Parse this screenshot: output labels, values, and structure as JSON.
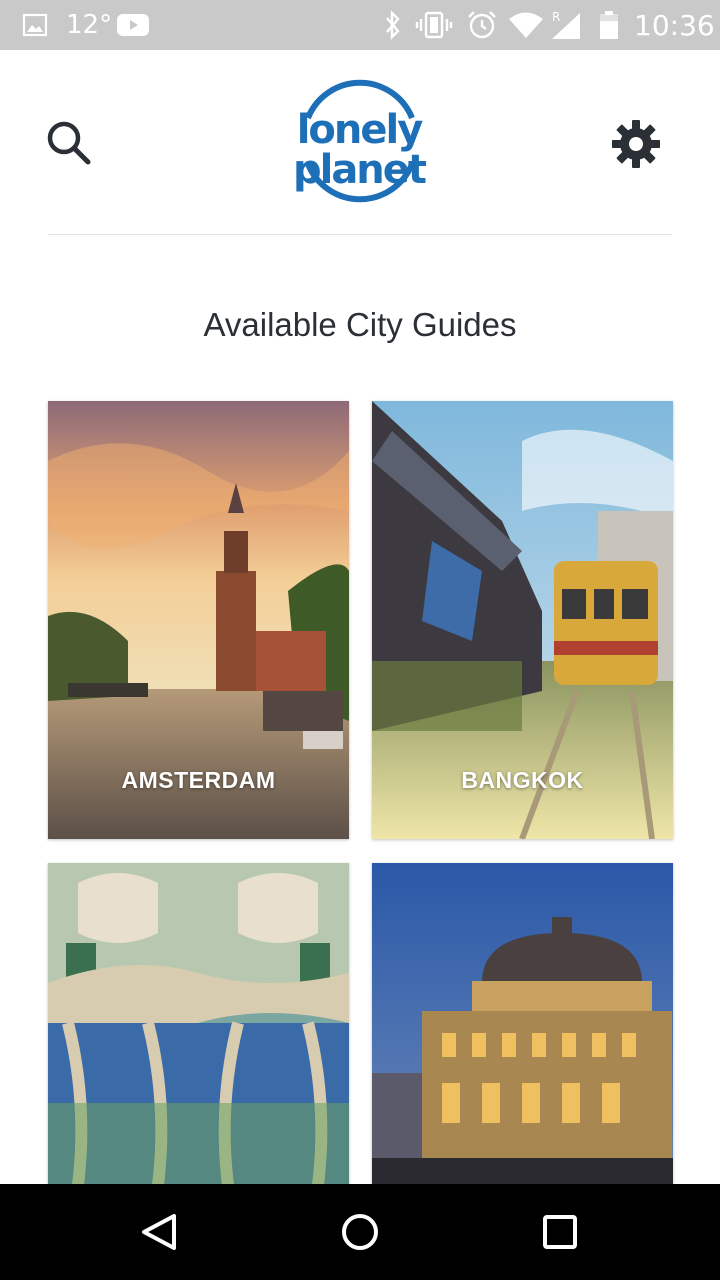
{
  "status_bar": {
    "temperature": "12°",
    "time": "10:36",
    "icons": [
      "image-icon",
      "youtube-icon",
      "bluetooth-icon",
      "vibrate-icon",
      "alarm-icon",
      "wifi-icon",
      "signal-icon",
      "battery-icon"
    ]
  },
  "header": {
    "logo_text": "lonely planet",
    "brand_color": "#1d6fb8",
    "search_icon": "search-icon",
    "settings_icon": "gear-icon"
  },
  "main": {
    "title": "Available City Guides",
    "cities": [
      {
        "label": "AMSTERDAM"
      },
      {
        "label": "BANGKOK"
      },
      {
        "label": ""
      },
      {
        "label": ""
      }
    ]
  },
  "nav_bar": {
    "icons": [
      "back-icon",
      "home-icon",
      "recents-icon"
    ]
  }
}
